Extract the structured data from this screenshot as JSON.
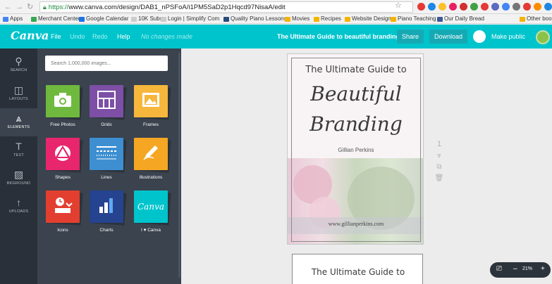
{
  "browser": {
    "url_scheme": "https://",
    "url_rest": "www.canva.com/design/DAB1_nPSFoA/i1PM5SaD2p1Hqcd97NisaA/edit",
    "bookmarks": [
      {
        "label": "Apps",
        "color": "#4285f4"
      },
      {
        "label": "Merchant Center",
        "color": "#34a853"
      },
      {
        "label": "Google Calendar",
        "color": "#1a73e8"
      },
      {
        "label": "10K Subs",
        "color": "#cccccc"
      },
      {
        "label": "Login | Simplify Com",
        "color": "#cccccc"
      },
      {
        "label": "Quality Piano Lessons",
        "color": "#2a4b7c"
      },
      {
        "label": "Movies",
        "color": "#f4b400"
      },
      {
        "label": "Recipes",
        "color": "#f4b400"
      },
      {
        "label": "Website Design",
        "color": "#f4b400"
      },
      {
        "label": "Piano Teaching",
        "color": "#f4b400"
      },
      {
        "label": "Our Daily Bread",
        "color": "#3b5998"
      },
      {
        "label": "Other bookmarks",
        "color": "#f4b400"
      }
    ],
    "extension_colors": [
      "#e53935",
      "#1e88e5",
      "#fbc02d",
      "#e91e63",
      "#d32f2f",
      "#43a047",
      "#e53935",
      "#5c6bc0",
      "#4285f4",
      "#757575",
      "#e53935",
      "#fb8c00",
      "#1e88e5"
    ]
  },
  "topbar": {
    "logo": "Canva",
    "menu": [
      "File",
      "Undo",
      "Redo",
      "Help"
    ],
    "status": "No changes made",
    "design_title": "The Ultimate Guide to beautiful branding",
    "share_label": "Share",
    "download_label": "Download",
    "make_public_label": "Make public",
    "accent": "#00c4cc"
  },
  "rail": [
    {
      "label": "SEARCH",
      "icon": "search-icon",
      "glyph": "⚲"
    },
    {
      "label": "LAYOUTS",
      "icon": "layouts-icon",
      "glyph": "◫"
    },
    {
      "label": "ELEMENTS",
      "icon": "elements-icon",
      "glyph": "⩓"
    },
    {
      "label": "TEXT",
      "icon": "text-icon",
      "glyph": "T"
    },
    {
      "label": "BKGROUND",
      "icon": "background-icon",
      "glyph": "▨"
    },
    {
      "label": "UPLOADS",
      "icon": "upload-icon",
      "glyph": "↑"
    }
  ],
  "panel": {
    "search_placeholder": "Search 1,000,000 images...",
    "tiles": [
      {
        "label": "Free Photos",
        "color": "#6fba3e",
        "icon": "camera-icon"
      },
      {
        "label": "Grids",
        "color": "#7d4fa6",
        "icon": "grid-icon"
      },
      {
        "label": "Frames",
        "color": "#f6b73c",
        "icon": "frame-icon"
      },
      {
        "label": "Shapes",
        "color": "#e8266d",
        "icon": "shapes-icon"
      },
      {
        "label": "Lines",
        "color": "#3d8fd1",
        "icon": "lines-icon"
      },
      {
        "label": "Illustrations",
        "color": "#f5a623",
        "icon": "pencil-icon"
      },
      {
        "label": "Icons",
        "color": "#e33f30",
        "icon": "icons-icon"
      },
      {
        "label": "Charts",
        "color": "#25438e",
        "icon": "chart-icon"
      },
      {
        "label": "I ♥ Canva",
        "color": "#00c4cc",
        "icon": "canva-icon"
      }
    ],
    "canva_tile_text": "Canva"
  },
  "canvas": {
    "page1": {
      "title": "The Ultimate Guide to",
      "script1": "Beautiful",
      "script2": "Branding",
      "author": "Gillian Perkins",
      "url": "www.gillianperkins.com"
    },
    "page2": {
      "title": "The Ultimate Guide to"
    },
    "page_number": "1",
    "zoom": "21%"
  }
}
